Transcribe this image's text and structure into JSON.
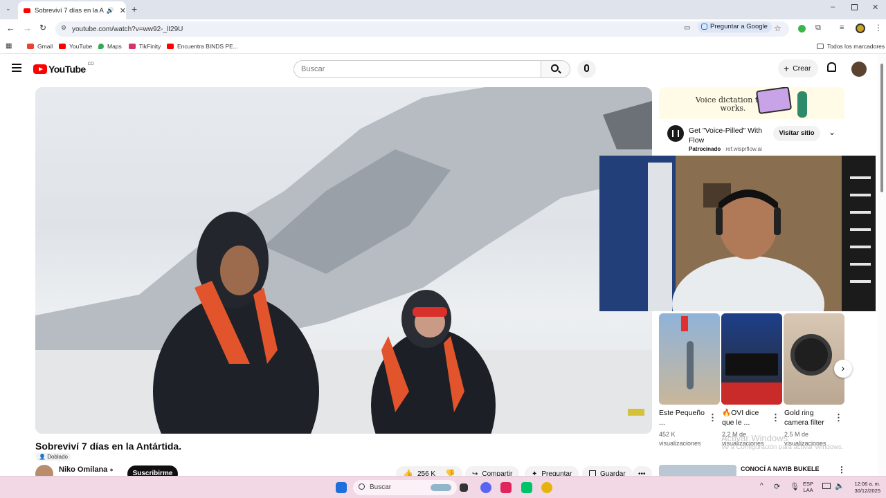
{
  "browser": {
    "tab_title": "Sobreviví 7 días en la Antártida.",
    "url": "youtube.com/watch?v=ww92-_lI29U",
    "ask_google": "Preguntar a Google",
    "bookmarks": [
      "Gmail",
      "YouTube",
      "Maps",
      "TikFinity",
      "Encuentra BINDS PE..."
    ],
    "all_bookmarks": "Todos los marcadores"
  },
  "header": {
    "logo": "YouTube",
    "country": "CO",
    "search_placeholder": "Buscar",
    "create_label": "Crear"
  },
  "video": {
    "title": "Sobreviví 7 días en la Antártida.",
    "dubbed_label": "Doblado",
    "channel": "Niko Omilana",
    "subscribe_label": "Suscribirme",
    "likes": "256 K",
    "share_label": "Compartir",
    "ask_label": "Preguntar",
    "save_label": "Guardar"
  },
  "ad": {
    "banner_headline": "Voice dictation that works.",
    "title": "Get \"Voice-Pilled\" With Flow",
    "sponsored": "Patrocinado",
    "domain": "ref.wisprflow.ai",
    "visit_label": "Visitar sitio"
  },
  "shorts": [
    {
      "title": "Este Pequeño ...",
      "views": "452 K visualizaciones",
      "colors": [
        "#8fb3d9",
        "#c9b79a"
      ]
    },
    {
      "title": "OVI dice que le ...",
      "views": "2,2 M de visualizaciones",
      "colors": [
        "#1d3f8a",
        "#c92a2a"
      ]
    },
    {
      "title": "Gold ring camera filter",
      "views": "2,5 M de visualizaciones",
      "colors": [
        "#d8c7b3",
        "#2a2a2a"
      ]
    }
  ],
  "next_video": {
    "title": "CONOCÍ A NAYIB BUKELE"
  },
  "watermark": {
    "line1": "Activar Windows",
    "line2": "Ve a Configuración para activar Windows."
  },
  "taskbar": {
    "search_placeholder": "Buscar",
    "lang_top": "ESP",
    "lang_bottom": "LAA",
    "time": "12:06 a. m.",
    "date": "30/12/2025"
  }
}
